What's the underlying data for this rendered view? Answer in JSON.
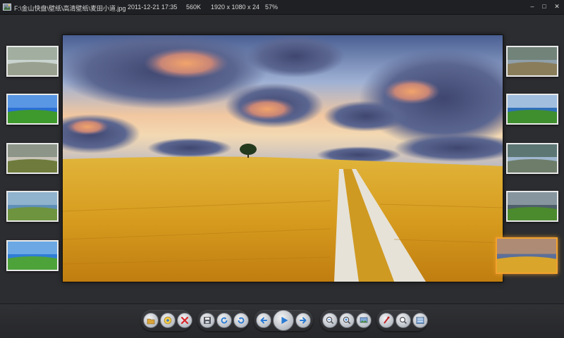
{
  "titlebar": {
    "file_path": "F:\\金山快盘\\壁纸\\高清壁纸\\麦田小道.jpg",
    "date": "2011-12-21 17:35",
    "size": "560K",
    "dimensions": "1920 x 1080 x 24",
    "zoom": "57%",
    "minimize_icon": "minimize-icon",
    "maximize_icon": "maximize-icon",
    "close_icon": "close-icon"
  },
  "main_image": {
    "subject": "wheat field with a dirt road under a sunset sky"
  },
  "thumbnails_left": [
    {
      "name": "misty-forest-road",
      "colors": [
        "#c9d3cf",
        "#7f8f7a",
        "#9aa08f"
      ]
    },
    {
      "name": "green-hill-blue-sky",
      "colors": [
        "#2a6fd4",
        "#7fb6ee",
        "#3e9a2c"
      ]
    },
    {
      "name": "lake-meadow",
      "colors": [
        "#c8c4b8",
        "#5d6f62",
        "#6e7b3c"
      ]
    },
    {
      "name": "house-on-hill",
      "colors": [
        "#5d8fb7",
        "#b9d2e2",
        "#6e9440"
      ]
    },
    {
      "name": "field-path-blue-sky",
      "colors": [
        "#2f7ed6",
        "#9ccaf0",
        "#4ea23a"
      ]
    }
  ],
  "thumbnails_right": [
    {
      "name": "mountain-valley",
      "colors": [
        "#8fa0ab",
        "#5b6b52",
        "#8a7d5a"
      ]
    },
    {
      "name": "clouds-green-plain",
      "colors": [
        "#2f6fb8",
        "#ffffff",
        "#3f8f2e"
      ]
    },
    {
      "name": "tree-lined-road",
      "colors": [
        "#9fb7cf",
        "#24412a",
        "#6d7d6a"
      ]
    },
    {
      "name": "stormy-green-field",
      "colors": [
        "#4e5f6a",
        "#b6c3c8",
        "#4c8a2e"
      ]
    },
    {
      "name": "wheat-field-road-selected",
      "colors": [
        "#5d6f98",
        "#f1a25a",
        "#d9a62b"
      ]
    }
  ],
  "toolbar": {
    "groups": [
      {
        "name": "file-group",
        "buttons": [
          "open-folder-icon",
          "browse-icon",
          "delete-icon"
        ]
      },
      {
        "name": "edit-group",
        "buttons": [
          "save-icon",
          "rotate-left-icon",
          "rotate-right-icon"
        ]
      },
      {
        "name": "nav-group",
        "buttons": [
          "previous-icon",
          "play-icon",
          "next-icon"
        ]
      },
      {
        "name": "zoom-group",
        "buttons": [
          "zoom-out-icon",
          "zoom-in-icon",
          "fit-screen-icon"
        ]
      },
      {
        "name": "tools-group",
        "buttons": [
          "settings-icon",
          "search-icon",
          "fullscreen-icon"
        ]
      }
    ],
    "accent_color": "#2a7bd3"
  }
}
